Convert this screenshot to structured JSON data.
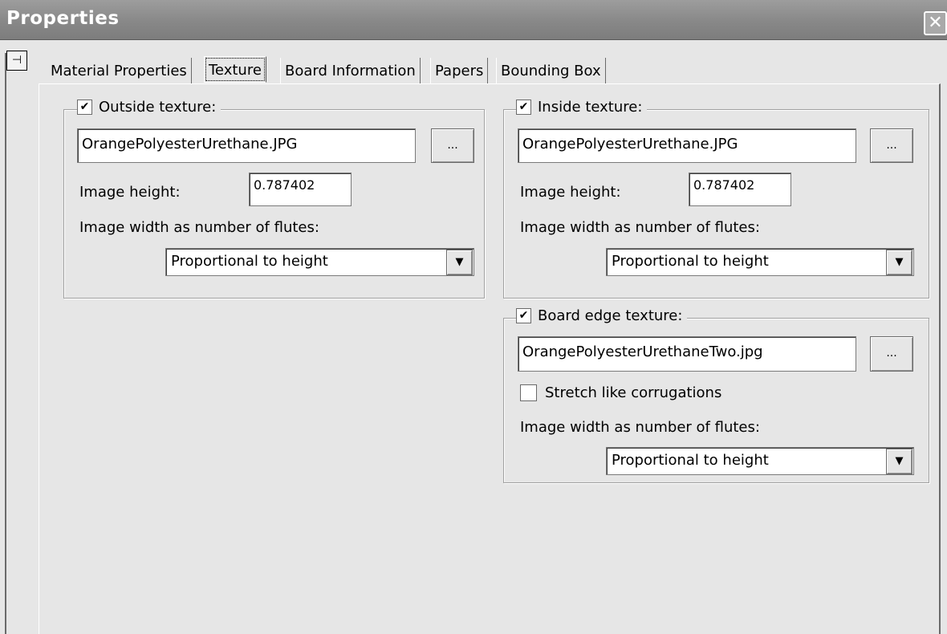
{
  "window": {
    "title": "Properties",
    "close_glyph": "✕",
    "pin_glyph": "⊣"
  },
  "tabs": [
    {
      "label": "Material Properties"
    },
    {
      "label": "Texture",
      "active": true
    },
    {
      "label": "Board Information"
    },
    {
      "label": "Papers"
    },
    {
      "label": "Bounding Box"
    }
  ],
  "outside": {
    "legend": "Outside texture:",
    "checked": true,
    "file": "OrangePolyesterUrethane.JPG",
    "browse_label": "...",
    "height_label": "Image height:",
    "height_value": "0.787402",
    "width_label": "Image width as number of flutes:",
    "width_option": "Proportional to height"
  },
  "inside": {
    "legend": "Inside texture:",
    "checked": true,
    "file": "OrangePolyesterUrethane.JPG",
    "browse_label": "...",
    "height_label": "Image height:",
    "height_value": "0.787402",
    "width_label": "Image width as number of flutes:",
    "width_option": "Proportional to height"
  },
  "edge": {
    "legend": "Board edge texture:",
    "checked": true,
    "file": "OrangePolyesterUrethaneTwo.jpg",
    "browse_label": "...",
    "stretch_label": "Stretch like corrugations",
    "stretch_checked": false,
    "width_label": "Image width as number of flutes:",
    "width_option": "Proportional to height"
  },
  "glyphs": {
    "check": "✔",
    "dropdown": "▼"
  }
}
